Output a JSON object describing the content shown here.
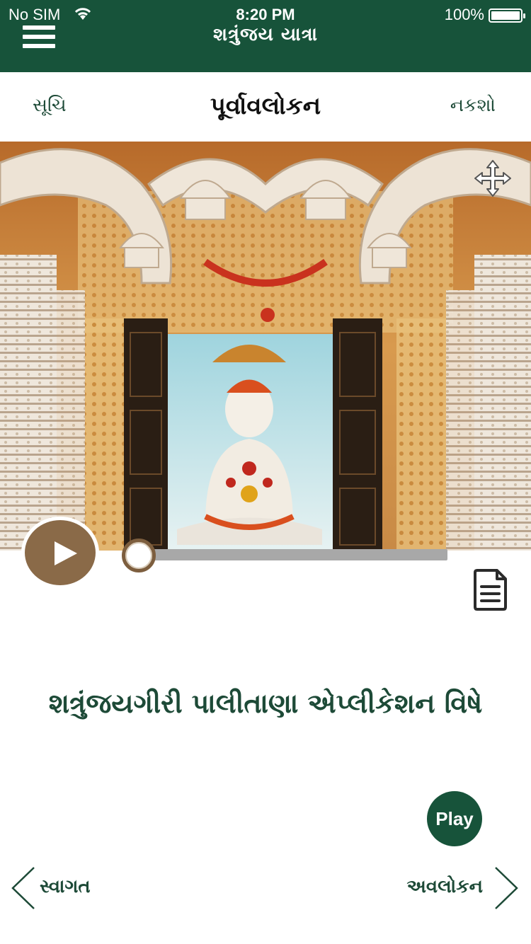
{
  "status_bar": {
    "carrier": "No SIM",
    "time": "8:20 PM",
    "battery": "100%"
  },
  "header": {
    "app_title": "શત્રુંજય યાત્રા",
    "menu_icon": "hamburger-menu-icon"
  },
  "nav": {
    "left_label": "સૂચિ",
    "center_title": "પૂર્વાવલોકન",
    "right_label": "નકશો"
  },
  "hero": {
    "image_description_icon": "temple-photo",
    "expand_icon": "move-arrows-icon"
  },
  "audio": {
    "play_icon": "play-icon",
    "progress": 0,
    "transcript_icon": "document-icon"
  },
  "content": {
    "heading": "શત્રુંજયગીરી પાલીતાણા એપ્લીકેશન વિષે"
  },
  "play_button": {
    "label": "Play"
  },
  "footer_nav": {
    "prev_label": "સ્વાગત",
    "next_label": "અવલોકન"
  },
  "colors": {
    "brand_green": "#17533a",
    "text_green": "#1d4a37",
    "audio_brown": "#8a6a48"
  }
}
